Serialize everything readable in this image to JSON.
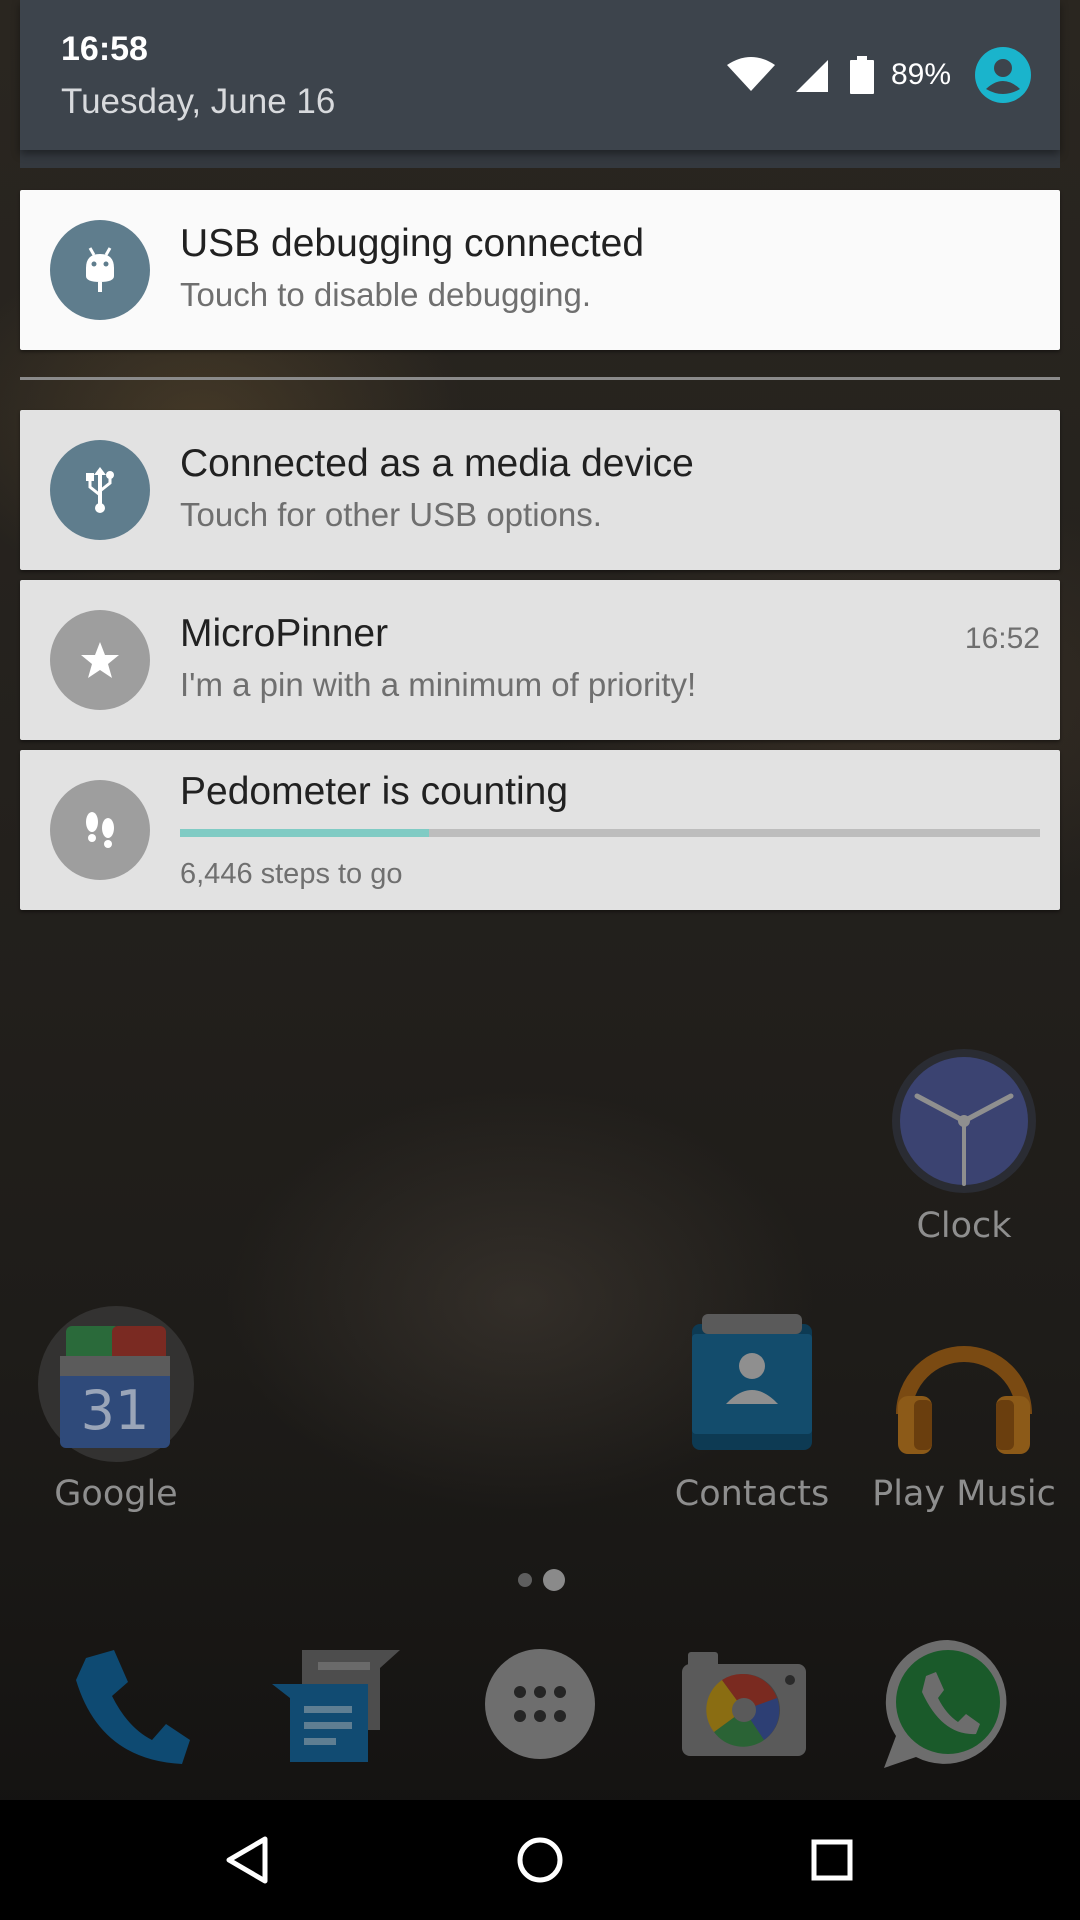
{
  "status": {
    "time": "16:58",
    "date": "Tuesday, June 16",
    "battery_percent": "89%",
    "icons": [
      "wifi-icon",
      "cell-signal-icon",
      "battery-icon",
      "user-avatar-icon"
    ]
  },
  "notifications": [
    {
      "title": "USB debugging connected",
      "text": "Touch to disable debugging.",
      "icon": "android-debug-icon"
    },
    {
      "title": "Connected as a media device",
      "text": "Touch for other USB options.",
      "icon": "usb-icon"
    },
    {
      "title": "MicroPinner",
      "text": "I'm a pin with a minimum of priority!",
      "time": "16:52",
      "icon": "star-icon"
    },
    {
      "title": "Pedometer is counting",
      "text": "6,446 steps to go",
      "progress": 0.29,
      "icon": "footprints-icon"
    }
  ],
  "home": {
    "apps": [
      {
        "label": "Clock",
        "icon": "clock-icon"
      },
      {
        "label": "Google",
        "icon": "google-folder-icon"
      },
      {
        "label": "Contacts",
        "icon": "contacts-icon"
      },
      {
        "label": "Play Music",
        "icon": "headphones-icon"
      }
    ],
    "calendar_day": "31",
    "page_count": 2,
    "current_page": 2,
    "dock": [
      "phone-icon",
      "messages-icon",
      "app-drawer-icon",
      "camera-icon",
      "whatsapp-icon"
    ]
  },
  "nav": [
    "back-icon",
    "home-icon",
    "recents-icon"
  ],
  "colors": {
    "header_bg": "#3d444c",
    "notif_bg": "#e2e2e2",
    "notif_highlight_bg": "#fafafa",
    "icon_bluegray": "#5f7d8d",
    "icon_gray": "#9e9e9e",
    "progress": "#80cbc4",
    "avatar": "#1ab4cc"
  }
}
